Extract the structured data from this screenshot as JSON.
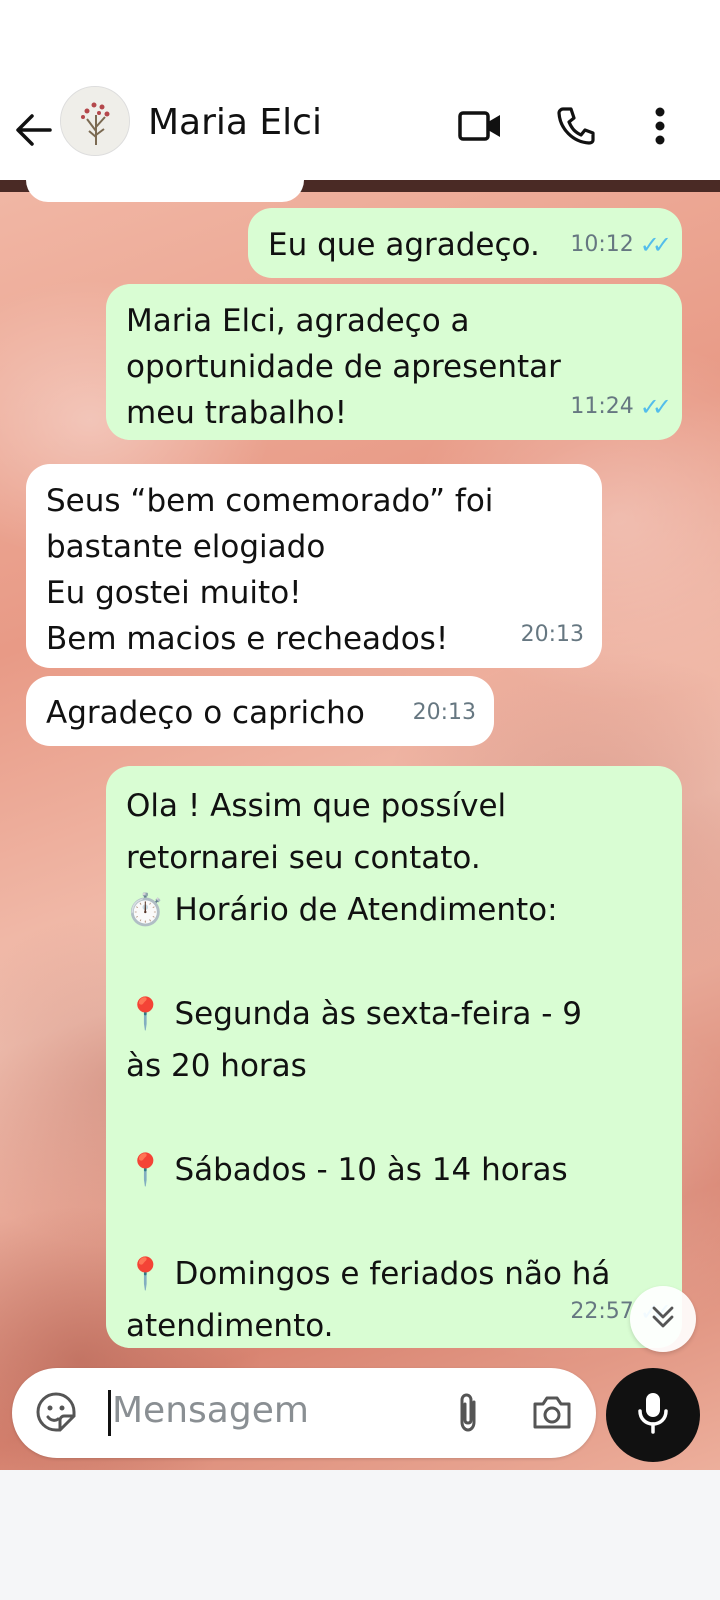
{
  "header": {
    "contact_name": "Maria Elci",
    "back_icon": "arrow-left-icon",
    "video_icon": "video-call-icon",
    "call_icon": "phone-icon",
    "menu_icon": "more-vertical-icon"
  },
  "messages": [
    {
      "direction": "out",
      "text": "Eu que agradeço.",
      "time": "10:12",
      "status": "read"
    },
    {
      "direction": "out",
      "text": "Maria Elci, agradeço a\noportunidade de apresentar\nmeu trabalho!",
      "time": "11:24",
      "status": "read"
    },
    {
      "direction": "in",
      "text": "Seus “bem comemorado” foi\nbastante elogiado\nEu gostei muito!\nBem macios e recheados!",
      "time": "20:13"
    },
    {
      "direction": "in",
      "text": "Agradeço o capricho",
      "time": "20:13"
    },
    {
      "direction": "out",
      "text": "Ola ! Assim que possível\nretornarei seu contato.\n⏱️ Horário de Atendimento:\n\n📍 Segunda às sexta-feira - 9\nàs 20 horas\n\n📍 Sábados - 10 às 14 horas\n\n📍 Domingos e feriados não há\natendimento.",
      "time": "22:57",
      "status": "read"
    }
  ],
  "composer": {
    "placeholder": "Mensagem",
    "emoji_icon": "sticker-icon",
    "attach_icon": "paperclip-icon",
    "camera_icon": "camera-icon",
    "mic_icon": "microphone-icon"
  },
  "colors": {
    "outgoing_bubble": "#d9fdd3",
    "incoming_bubble": "#ffffff",
    "read_ticks": "#53bdeb"
  }
}
